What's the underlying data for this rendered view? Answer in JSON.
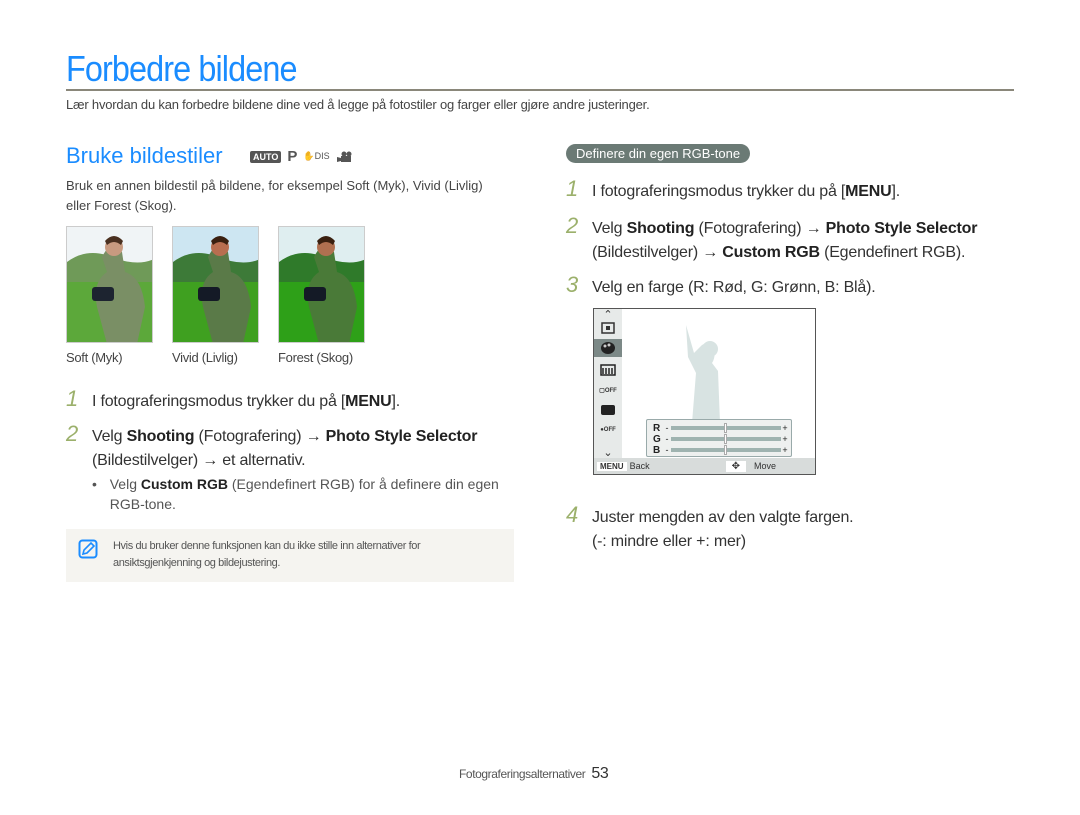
{
  "page": {
    "title": "Forbedre bildene",
    "intro": "Lær hvordan du kan forbedre bildene dine ved å legge på fotostiler og farger eller gjøre andre justeringer."
  },
  "left": {
    "section_title": "Bruke bildestiler",
    "mode_icons": [
      "auto-mode-icon",
      "program-mode-icon",
      "dual-is-icon",
      "movie-mode-icon"
    ],
    "mode_labels": {
      "auto": "AUTO",
      "p": "P",
      "dis": "DIS"
    },
    "description": "Bruk en annen bildestil på bildene, for eksempel Soft (Myk), Vivid (Livlig) eller Forest (Skog).",
    "thumbnails": [
      {
        "caption": "Soft (Myk)"
      },
      {
        "caption": "Vivid (Livlig)"
      },
      {
        "caption": "Forest (Skog)"
      }
    ],
    "steps": [
      {
        "num": "1",
        "pre": "I fotograferingsmodus trykker du på [",
        "key": "MENU",
        "post": "]."
      },
      {
        "num": "2",
        "pre": "Velg ",
        "b1": "Shooting",
        "mid1": " (Fotografering) → ",
        "b2": "Photo Style Selector",
        "line2": "(Bildestilvelger) → et alternativ."
      }
    ],
    "bullet": {
      "pre": "Velg ",
      "bold": "Custom RGB",
      "post": " (Egendefinert RGB) for å definere din egen RGB-tone."
    },
    "note": "Hvis du bruker denne funksjonen kan du ikke stille inn alternativer for ansiktsgjenkjenning og bildejustering."
  },
  "right": {
    "pill": "Definere din egen RGB-tone",
    "steps": [
      {
        "num": "1",
        "pre": "I fotograferingsmodus trykker du på [",
        "key": "MENU",
        "post": "]."
      },
      {
        "num": "2",
        "pre": "Velg ",
        "b1": "Shooting",
        "mid1": " (Fotografering) → ",
        "b2": "Photo Style Selector",
        "line2_pre": "(Bildestilvelger) → ",
        "line2_bold": "Custom RGB",
        "line2_post": " (Egendefinert RGB)."
      },
      {
        "num": "3",
        "text": "Velg en farge (R: Rød, G: Grønn, B: Blå)."
      },
      {
        "num": "4",
        "text": "Juster mengden av den valgte fargen.",
        "line2": "(-: mindre eller +: mer)"
      }
    ],
    "screen": {
      "menu_key": "MENU",
      "back_label": "Back",
      "move_label": "Move",
      "sliders": [
        {
          "label": "R",
          "value": 0.5
        },
        {
          "label": "G",
          "value": 0.5
        },
        {
          "label": "B",
          "value": 0.5
        }
      ],
      "minus": "-",
      "plus": "+"
    }
  },
  "footer": {
    "section": "Fotograferingsalternativer",
    "page_number": "53"
  }
}
